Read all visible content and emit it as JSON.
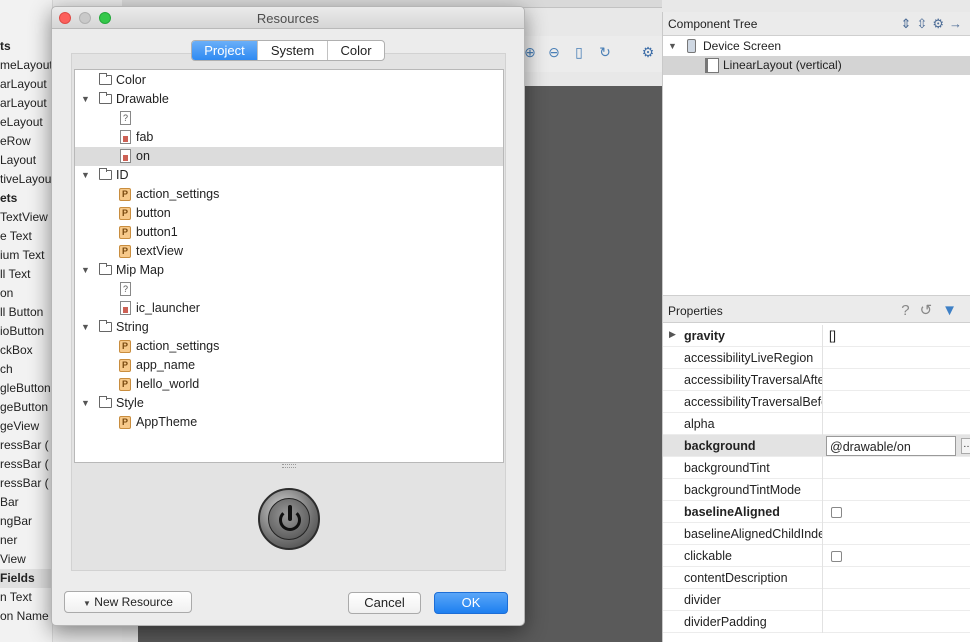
{
  "palette": {
    "items": [
      {
        "label": "ts",
        "header": true
      },
      {
        "label": "meLayout"
      },
      {
        "label": "arLayout"
      },
      {
        "label": "arLayout"
      },
      {
        "label": "eLayout"
      },
      {
        "label": "eRow"
      },
      {
        "label": "Layout"
      },
      {
        "label": "tiveLayout"
      },
      {
        "label": "ets",
        "header": true
      },
      {
        "label": "TextView"
      },
      {
        "label": "e Text"
      },
      {
        "label": "ium Text"
      },
      {
        "label": "ll Text"
      },
      {
        "label": "on"
      },
      {
        "label": "ll Button"
      },
      {
        "label": "ioButton"
      },
      {
        "label": "ckBox"
      },
      {
        "label": "ch"
      },
      {
        "label": "gleButton"
      },
      {
        "label": "geButton"
      },
      {
        "label": "geView"
      },
      {
        "label": "ressBar ("
      },
      {
        "label": "ressBar ("
      },
      {
        "label": "ressBar ("
      },
      {
        "label": "Bar"
      },
      {
        "label": "ngBar"
      },
      {
        "label": "ner"
      },
      {
        "label": "View"
      },
      {
        "label": "Fields",
        "header": true
      },
      {
        "label": "n Text"
      },
      {
        "label": "on Name"
      }
    ]
  },
  "component_tree": {
    "title": "Component Tree",
    "rows": [
      {
        "label": "Device Screen",
        "selected": false
      },
      {
        "label": "LinearLayout (vertical)",
        "selected": true
      }
    ]
  },
  "properties": {
    "title": "Properties",
    "rows": [
      {
        "name": "gravity",
        "bold": true,
        "value": "[]"
      },
      {
        "name": "accessibilityLiveRegion",
        "bold": false,
        "value": ""
      },
      {
        "name": "accessibilityTraversalAfter",
        "bold": false,
        "value": ""
      },
      {
        "name": "accessibilityTraversalBefore",
        "bold": false,
        "value": ""
      },
      {
        "name": "alpha",
        "bold": false,
        "value": ""
      },
      {
        "name": "background",
        "bold": true,
        "value": "@drawable/on",
        "selected": true
      },
      {
        "name": "backgroundTint",
        "bold": false,
        "value": ""
      },
      {
        "name": "backgroundTintMode",
        "bold": false,
        "value": ""
      },
      {
        "name": "baselineAligned",
        "bold": true,
        "value": ""
      },
      {
        "name": "baselineAlignedChildIndex",
        "bold": false,
        "value": ""
      },
      {
        "name": "clickable",
        "bold": false,
        "value": ""
      },
      {
        "name": "contentDescription",
        "bold": false,
        "value": ""
      },
      {
        "name": "divider",
        "bold": false,
        "value": ""
      },
      {
        "name": "dividerPadding",
        "bold": false,
        "value": ""
      }
    ]
  },
  "dialog": {
    "title": "Resources",
    "tabs": [
      {
        "label": "Project",
        "active": true
      },
      {
        "label": "System",
        "active": false
      },
      {
        "label": "Color",
        "active": false
      }
    ],
    "tree": [
      {
        "label": "Color",
        "type": "folder",
        "expanded": false
      },
      {
        "label": "Drawable",
        "type": "folder",
        "expanded": true
      },
      {
        "label": "",
        "type": "unknown"
      },
      {
        "label": "fab",
        "type": "drawable"
      },
      {
        "label": "on",
        "type": "drawable",
        "selected": true
      },
      {
        "label": "ID",
        "type": "folder",
        "expanded": true
      },
      {
        "label": "action_settings",
        "type": "value"
      },
      {
        "label": "button",
        "type": "value"
      },
      {
        "label": "button1",
        "type": "value"
      },
      {
        "label": "textView",
        "type": "value"
      },
      {
        "label": "Mip Map",
        "type": "folder",
        "expanded": true
      },
      {
        "label": "",
        "type": "unknown"
      },
      {
        "label": "ic_launcher",
        "type": "drawable"
      },
      {
        "label": "String",
        "type": "folder",
        "expanded": true
      },
      {
        "label": "action_settings",
        "type": "value"
      },
      {
        "label": "app_name",
        "type": "value"
      },
      {
        "label": "hello_world",
        "type": "value"
      },
      {
        "label": "Style",
        "type": "folder",
        "expanded": true
      },
      {
        "label": "AppTheme",
        "type": "value"
      }
    ],
    "badge_letter": "P",
    "unknown_glyph": "?",
    "new_resource_label": "New Resource",
    "cancel_label": "Cancel",
    "ok_label": "OK"
  }
}
